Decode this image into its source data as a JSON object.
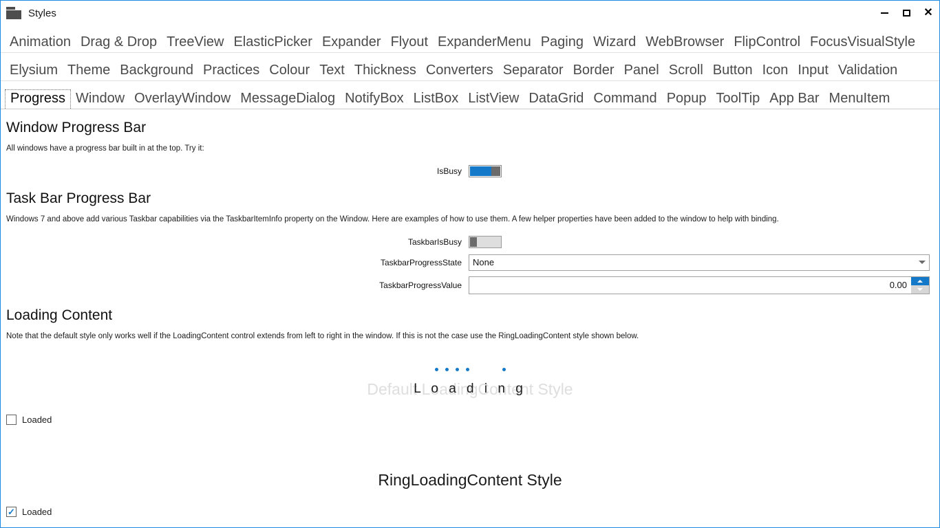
{
  "window": {
    "title": "Styles",
    "icon": "folder-icon",
    "accent_color": "#1479c8",
    "border_color": "#1a8ae5",
    "controls": {
      "minimize": "minimize-icon",
      "maximize": "maximize-icon",
      "close": "close-icon"
    }
  },
  "tab_rows": [
    {
      "tabs": [
        {
          "label": "Animation",
          "selected": false
        },
        {
          "label": "Drag & Drop",
          "selected": false
        },
        {
          "label": "TreeView",
          "selected": false
        },
        {
          "label": "ElasticPicker",
          "selected": false
        },
        {
          "label": "Expander",
          "selected": false
        },
        {
          "label": "Flyout",
          "selected": false
        },
        {
          "label": "ExpanderMenu",
          "selected": false
        },
        {
          "label": "Paging",
          "selected": false
        },
        {
          "label": "Wizard",
          "selected": false
        },
        {
          "label": "WebBrowser",
          "selected": false
        },
        {
          "label": "FlipControl",
          "selected": false
        },
        {
          "label": "FocusVisualStyle",
          "selected": false
        }
      ]
    },
    {
      "tabs": [
        {
          "label": "Elysium",
          "selected": false
        },
        {
          "label": "Theme",
          "selected": false
        },
        {
          "label": "Background",
          "selected": false
        },
        {
          "label": "Practices",
          "selected": false
        },
        {
          "label": "Colour",
          "selected": false
        },
        {
          "label": "Text",
          "selected": false
        },
        {
          "label": "Thickness",
          "selected": false
        },
        {
          "label": "Converters",
          "selected": false
        },
        {
          "label": "Separator",
          "selected": false
        },
        {
          "label": "Border",
          "selected": false
        },
        {
          "label": "Panel",
          "selected": false
        },
        {
          "label": "Scroll",
          "selected": false
        },
        {
          "label": "Button",
          "selected": false
        },
        {
          "label": "Icon",
          "selected": false
        },
        {
          "label": "Input",
          "selected": false
        },
        {
          "label": "Validation",
          "selected": false
        }
      ]
    },
    {
      "tabs": [
        {
          "label": "Progress",
          "selected": true
        },
        {
          "label": "Window",
          "selected": false
        },
        {
          "label": "OverlayWindow",
          "selected": false
        },
        {
          "label": "MessageDialog",
          "selected": false
        },
        {
          "label": "NotifyBox",
          "selected": false
        },
        {
          "label": "ListBox",
          "selected": false
        },
        {
          "label": "ListView",
          "selected": false
        },
        {
          "label": "DataGrid",
          "selected": false
        },
        {
          "label": "Command",
          "selected": false
        },
        {
          "label": "Popup",
          "selected": false
        },
        {
          "label": "ToolTip",
          "selected": false
        },
        {
          "label": "App Bar",
          "selected": false
        },
        {
          "label": "MenuItem",
          "selected": false
        }
      ]
    }
  ],
  "sections": {
    "window_progress": {
      "heading": "Window Progress Bar",
      "description": "All windows have a progress bar built in at the top. Try it:",
      "is_busy": {
        "label": "IsBusy",
        "state": "on"
      }
    },
    "task_bar_progress": {
      "heading": "Task Bar Progress Bar",
      "description": "Windows 7 and above add various Taskbar capabilities via the TaskbarItemInfo property on the Window. Here are examples of how to use them. A few helper properties have been added to the window to help with binding.",
      "taskbar_is_busy": {
        "label": "TaskbarIsBusy",
        "state": "off"
      },
      "taskbar_progress_state": {
        "label": "TaskbarProgressState",
        "value": "None"
      },
      "taskbar_progress_value": {
        "label": "TaskbarProgressValue",
        "value": "0.00"
      }
    },
    "loading_content": {
      "heading": "Loading Content",
      "description": "Note that the default style only works well if the LoadingContent control extends from left to right in the window. If this is not the case use the RingLoadingContent style shown below.",
      "ghost_text": "Default LoadingContent Style",
      "loading_word": "L o a d i n g",
      "loaded_checkbox": {
        "label": "Loaded",
        "checked": false
      },
      "ring_title": "RingLoadingContent Style",
      "ring_loaded_checkbox": {
        "label": "Loaded",
        "checked": true
      }
    }
  }
}
